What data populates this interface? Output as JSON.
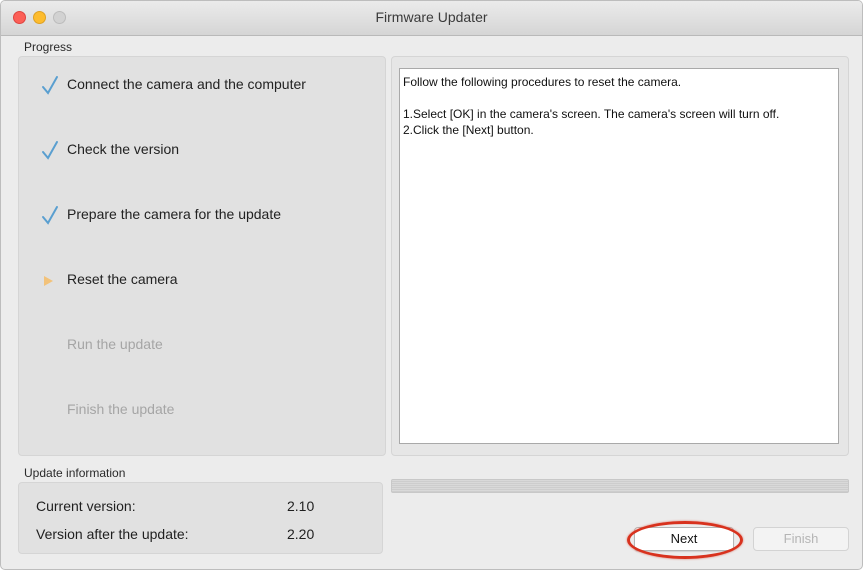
{
  "window": {
    "title": "Firmware Updater"
  },
  "progress": {
    "label": "Progress",
    "steps": [
      {
        "label": "Connect the camera and the computer",
        "state": "done",
        "icon": "check-icon"
      },
      {
        "label": "Check the version",
        "state": "done",
        "icon": "check-icon"
      },
      {
        "label": "Prepare the camera for the update",
        "state": "done",
        "icon": "check-icon"
      },
      {
        "label": "Reset the camera",
        "state": "current",
        "icon": "play-arrow-icon"
      },
      {
        "label": "Run the update",
        "state": "pending",
        "icon": ""
      },
      {
        "label": "Finish the update",
        "state": "pending",
        "icon": ""
      }
    ]
  },
  "instructions": {
    "intro": "Follow the following procedures to reset the camera.",
    "lines": [
      "1.Select [OK] in the camera's screen. The camera's screen will turn off.",
      "2.Click the [Next] button."
    ]
  },
  "update_info": {
    "label": "Update information",
    "current_label": "Current version:",
    "current_value": "2.10",
    "after_label": "Version after the update:",
    "after_value": "2.20"
  },
  "buttons": {
    "next": "Next",
    "finish": "Finish"
  },
  "colors": {
    "check": "#5a9fd0",
    "current_arrow": "#f2c27a",
    "highlight": "#d8321e"
  }
}
